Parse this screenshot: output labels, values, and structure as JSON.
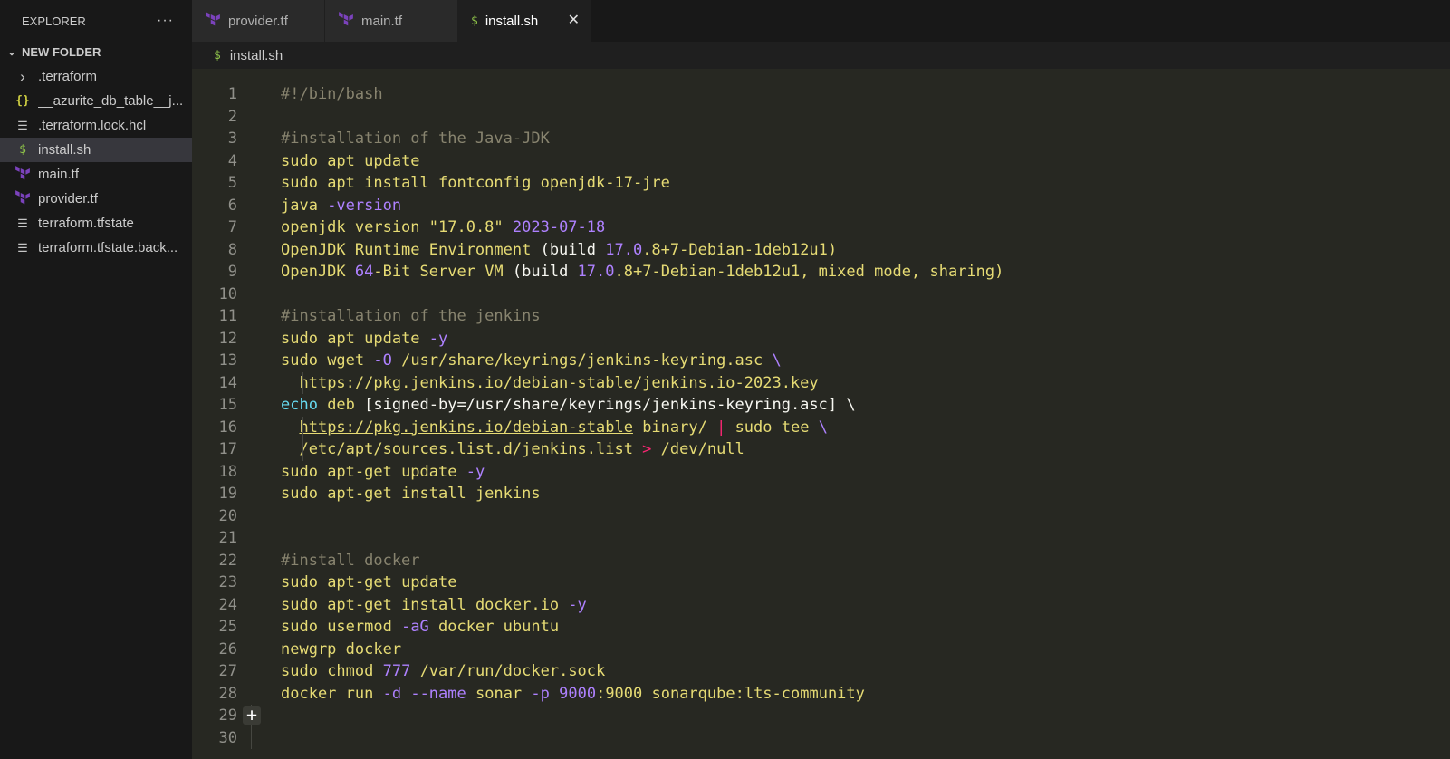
{
  "sidebar": {
    "title": "EXPLORER",
    "more": "···",
    "folder": "NEW FOLDER",
    "items": [
      {
        "label": ".terraform",
        "icon": "chevron-right-icon"
      },
      {
        "label": "__azurite_db_table__j...",
        "icon": "json-icon"
      },
      {
        "label": ".terraform.lock.hcl",
        "icon": "lines-icon"
      },
      {
        "label": "install.sh",
        "icon": "dollar-icon"
      },
      {
        "label": "main.tf",
        "icon": "terraform-icon"
      },
      {
        "label": "provider.tf",
        "icon": "terraform-icon"
      },
      {
        "label": "terraform.tfstate",
        "icon": "lines-icon"
      },
      {
        "label": "terraform.tfstate.back...",
        "icon": "lines-icon"
      }
    ]
  },
  "tabs": [
    {
      "label": "provider.tf",
      "icon": "terraform-icon"
    },
    {
      "label": "main.tf",
      "icon": "terraform-icon"
    },
    {
      "label": "install.sh",
      "icon": "dollar-icon",
      "close": "✕"
    }
  ],
  "breadcrumb": {
    "label": "install.sh"
  },
  "icons": {
    "dollar": "$",
    "json": "{}",
    "lines": "☰",
    "chevron_right": "›",
    "chevron_down": "⌄",
    "plus": "+"
  },
  "colors": {
    "terraform": "#7b42bc",
    "shell": "#8dc149",
    "json": "#cbcb41"
  },
  "editor": {
    "line_numbers": [
      "1",
      "2",
      "3",
      "4",
      "5",
      "6",
      "7",
      "8",
      "9",
      "10",
      "11",
      "12",
      "13",
      "14",
      "15",
      "16",
      "17",
      "18",
      "19",
      "20",
      "21",
      "22",
      "23",
      "24",
      "25",
      "26",
      "27",
      "28",
      "29",
      "30"
    ],
    "lines": [
      [
        {
          "t": "#!/bin/bash",
          "c": "com"
        }
      ],
      [],
      [
        {
          "t": "#installation of the Java-JDK",
          "c": "com"
        }
      ],
      [
        {
          "t": "sudo ",
          "c": "cmd"
        },
        {
          "t": "apt update",
          "c": "cmd"
        }
      ],
      [
        {
          "t": "sudo ",
          "c": "cmd"
        },
        {
          "t": "apt install fontconfig openjdk-17-jre",
          "c": "cmd"
        }
      ],
      [
        {
          "t": "java ",
          "c": "cmd"
        },
        {
          "t": "-version",
          "c": "flag"
        }
      ],
      [
        {
          "t": "openjdk version ",
          "c": "cmd"
        },
        {
          "t": "\"17.0.8\" ",
          "c": "str"
        },
        {
          "t": "2023-07-18",
          "c": "num"
        }
      ],
      [
        {
          "t": "OpenJDK Runtime Environment ",
          "c": "cmd"
        },
        {
          "t": "(build ",
          "c": "plain"
        },
        {
          "t": "17.0",
          "c": "num"
        },
        {
          "t": ".8+7-Debian-1deb12u1)",
          "c": "cmd"
        }
      ],
      [
        {
          "t": "OpenJDK ",
          "c": "cmd"
        },
        {
          "t": "64",
          "c": "num"
        },
        {
          "t": "-Bit Server VM ",
          "c": "cmd"
        },
        {
          "t": "(build ",
          "c": "plain"
        },
        {
          "t": "17.0",
          "c": "num"
        },
        {
          "t": ".8+7-Debian-1deb12u1, mixed mode, sharing)",
          "c": "cmd"
        }
      ],
      [],
      [
        {
          "t": "#installation of the jenkins",
          "c": "com"
        }
      ],
      [
        {
          "t": "sudo ",
          "c": "cmd"
        },
        {
          "t": "apt update ",
          "c": "cmd"
        },
        {
          "t": "-y",
          "c": "flag"
        }
      ],
      [
        {
          "t": "sudo ",
          "c": "cmd"
        },
        {
          "t": "wget ",
          "c": "cmd"
        },
        {
          "t": "-O ",
          "c": "flag"
        },
        {
          "t": "/usr/share/keyrings/jenkins-keyring.asc ",
          "c": "cmd"
        },
        {
          "t": "\\",
          "c": "flag"
        }
      ],
      [
        {
          "t": "  ",
          "c": "plain"
        },
        {
          "t": "https://pkg.jenkins.io/debian-stable/jenkins.io-2023.key",
          "c": "url"
        }
      ],
      [
        {
          "t": "echo ",
          "c": "kw"
        },
        {
          "t": "deb ",
          "c": "cmd"
        },
        {
          "t": "[signed-by=/usr/share/keyrings/jenkins-keyring.asc] \\",
          "c": "plain"
        }
      ],
      [
        {
          "t": "  ",
          "c": "plain"
        },
        {
          "t": "https://pkg.jenkins.io/debian-stable",
          "c": "url"
        },
        {
          "t": " binary/ ",
          "c": "cmd"
        },
        {
          "t": "| ",
          "c": "op"
        },
        {
          "t": "sudo ",
          "c": "cmd"
        },
        {
          "t": "tee ",
          "c": "cmd"
        },
        {
          "t": "\\",
          "c": "flag"
        }
      ],
      [
        {
          "t": "  /etc/apt/sources.list.d/jenkins.list ",
          "c": "cmd"
        },
        {
          "t": "> ",
          "c": "op"
        },
        {
          "t": "/dev/null",
          "c": "cmd"
        }
      ],
      [
        {
          "t": "sudo ",
          "c": "cmd"
        },
        {
          "t": "apt-get update ",
          "c": "cmd"
        },
        {
          "t": "-y",
          "c": "flag"
        }
      ],
      [
        {
          "t": "sudo ",
          "c": "cmd"
        },
        {
          "t": "apt-get install jenkins",
          "c": "cmd"
        }
      ],
      [],
      [],
      [
        {
          "t": "#install docker",
          "c": "com"
        }
      ],
      [
        {
          "t": "sudo ",
          "c": "cmd"
        },
        {
          "t": "apt-get update",
          "c": "cmd"
        }
      ],
      [
        {
          "t": "sudo ",
          "c": "cmd"
        },
        {
          "t": "apt-get install docker.io ",
          "c": "cmd"
        },
        {
          "t": "-y",
          "c": "flag"
        }
      ],
      [
        {
          "t": "sudo ",
          "c": "cmd"
        },
        {
          "t": "usermod ",
          "c": "cmd"
        },
        {
          "t": "-aG ",
          "c": "flag"
        },
        {
          "t": "docker ubuntu",
          "c": "cmd"
        }
      ],
      [
        {
          "t": "newgrp ",
          "c": "cmd"
        },
        {
          "t": "docker",
          "c": "cmd"
        }
      ],
      [
        {
          "t": "sudo ",
          "c": "cmd"
        },
        {
          "t": "chmod ",
          "c": "cmd"
        },
        {
          "t": "777 ",
          "c": "num"
        },
        {
          "t": "/var/run/docker.sock",
          "c": "cmd"
        }
      ],
      [
        {
          "t": "docker ",
          "c": "cmd"
        },
        {
          "t": "run ",
          "c": "cmd"
        },
        {
          "t": "-d ",
          "c": "flag"
        },
        {
          "t": "--name ",
          "c": "flag"
        },
        {
          "t": "sonar ",
          "c": "cmd"
        },
        {
          "t": "-p ",
          "c": "flag"
        },
        {
          "t": "9000",
          "c": "num"
        },
        {
          "t": ":9000 sonarqube:lts-community",
          "c": "cmd"
        }
      ],
      [],
      []
    ]
  }
}
